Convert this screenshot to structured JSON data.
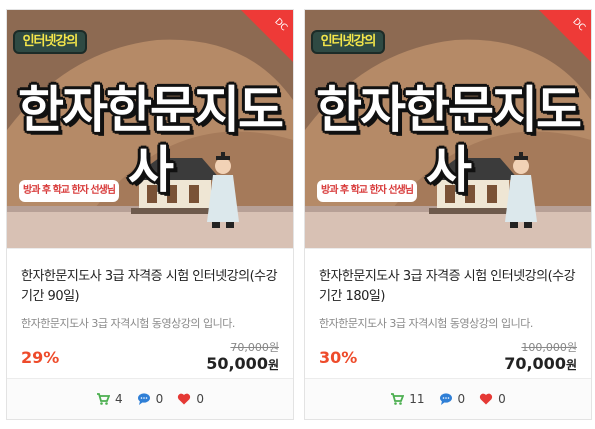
{
  "cards": [
    {
      "thumb": {
        "tag": "인터넷강의",
        "big_title": "한자한문지도사",
        "subtag": "방과 후 학교 한자 선생님",
        "badge": "DC"
      },
      "title": "한자한문지도사 3급 자격증 시험 인터넷강의(수강기간 90일)",
      "desc": "한자한문지도사 3급 자격시험 동영상강의 입니다.",
      "discount": "29%",
      "original_price": "70,000원",
      "price": "50,000",
      "price_unit": "원",
      "stats": {
        "cart": "4",
        "comments": "0",
        "likes": "0"
      }
    },
    {
      "thumb": {
        "tag": "인터넷강의",
        "big_title": "한자한문지도사",
        "subtag": "방과 후 학교 한자 선생님",
        "badge": "DC"
      },
      "title": "한자한문지도사 3급 자격증 시험 인터넷강의(수강기간 180일)",
      "desc": "한자한문지도사 3급 자격시험 동영상강의 입니다.",
      "discount": "30%",
      "original_price": "100,000원",
      "price": "70,000",
      "price_unit": "원",
      "stats": {
        "cart": "11",
        "comments": "0",
        "likes": "0"
      }
    }
  ],
  "colors": {
    "accent": "#ee4b2b",
    "ribbon": "#ee3a37",
    "cart": "#4caf50",
    "comment": "#2f7fd6",
    "heart": "#e53935"
  },
  "icons": {
    "cart": "cart-icon",
    "comment": "speech-bubble-icon",
    "like": "heart-icon"
  }
}
